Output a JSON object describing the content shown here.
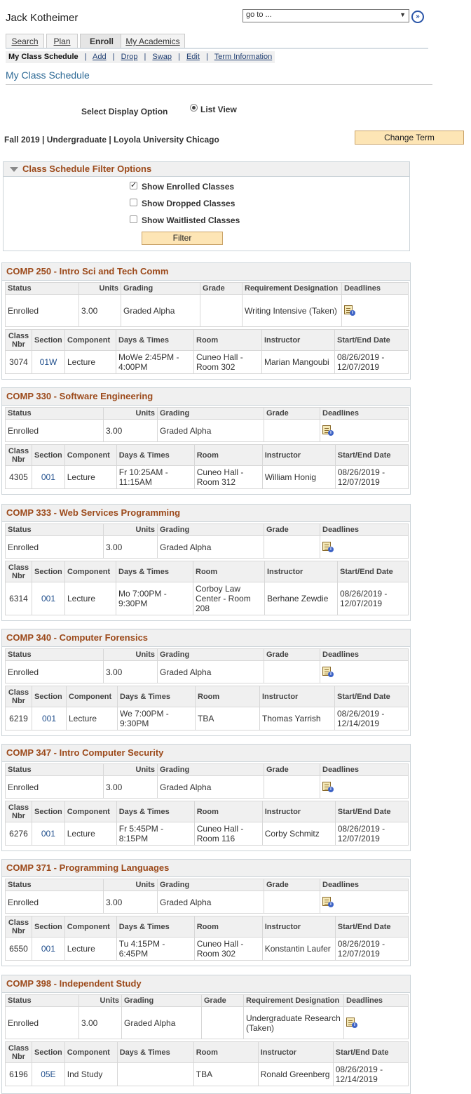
{
  "user_name": "Jack Kotheimer",
  "goto": {
    "value": "go to ..."
  },
  "tabs": [
    {
      "label": "Search"
    },
    {
      "label": "Plan"
    },
    {
      "label": "Enroll"
    },
    {
      "label": "My Academics"
    }
  ],
  "subnav": {
    "current": "My Class Schedule",
    "links": [
      "Add",
      "Drop",
      "Swap",
      "Edit",
      "Term Information"
    ]
  },
  "page_title": "My Class Schedule",
  "display_option": {
    "label": "Select Display Option",
    "radio_label": "List View"
  },
  "term_line": "Fall 2019 | Undergraduate | Loyola University Chicago",
  "change_term_label": "Change Term",
  "filter": {
    "title": "Class Schedule Filter Options",
    "options": [
      {
        "label": "Show Enrolled Classes",
        "checked": true
      },
      {
        "label": "Show Dropped Classes",
        "checked": false
      },
      {
        "label": "Show Waitlisted Classes",
        "checked": false
      }
    ],
    "button": "Filter"
  },
  "headers": {
    "status": "Status",
    "units": "Units",
    "grading": "Grading",
    "grade": "Grade",
    "requirement": "Requirement Designation",
    "deadlines": "Deadlines",
    "class_nbr": "Class Nbr",
    "section": "Section",
    "component": "Component",
    "days_times": "Days & Times",
    "room": "Room",
    "instructor": "Instructor",
    "start_end": "Start/End Date"
  },
  "courses": [
    {
      "title": "COMP 250 - Intro Sci and Tech Comm",
      "status": "Enrolled",
      "units": "3.00",
      "grading": "Graded Alpha",
      "grade": "",
      "requirement": "Writing Intensive (Taken)",
      "class_nbr": "3074",
      "section": "01W",
      "component": "Lecture",
      "days_times": "MoWe 2:45PM - 4:00PM",
      "room": "Cuneo Hall - Room 302",
      "instructor": "Marian Mangoubi",
      "start_end": "08/26/2019 - 12/07/2019"
    },
    {
      "title": "COMP 330 - Software Engineering",
      "status": "Enrolled",
      "units": "3.00",
      "grading": "Graded Alpha",
      "grade": "",
      "class_nbr": "4305",
      "section": "001",
      "component": "Lecture",
      "days_times": "Fr 10:25AM - 11:15AM",
      "room": "Cuneo Hall - Room 312",
      "instructor": "William Honig",
      "start_end": "08/26/2019 - 12/07/2019"
    },
    {
      "title": "COMP 333 - Web Services Programming",
      "status": "Enrolled",
      "units": "3.00",
      "grading": "Graded Alpha",
      "grade": "",
      "class_nbr": "6314",
      "section": "001",
      "component": "Lecture",
      "days_times": "Mo 7:00PM - 9:30PM",
      "room": "Corboy Law Center - Room 208",
      "instructor": "Berhane Zewdie",
      "start_end": "08/26/2019 - 12/07/2019"
    },
    {
      "title": "COMP 340 - Computer Forensics",
      "status": "Enrolled",
      "units": "3.00",
      "grading": "Graded Alpha",
      "grade": "",
      "class_nbr": "6219",
      "section": "001",
      "component": "Lecture",
      "days_times": "We 7:00PM - 9:30PM",
      "room": "TBA",
      "instructor": "Thomas Yarrish",
      "start_end": "08/26/2019 - 12/14/2019"
    },
    {
      "title": "COMP 347 - Intro Computer Security",
      "status": "Enrolled",
      "units": "3.00",
      "grading": "Graded Alpha",
      "grade": "",
      "class_nbr": "6276",
      "section": "001",
      "component": "Lecture",
      "days_times": "Fr 5:45PM - 8:15PM",
      "room": "Cuneo Hall - Room 116",
      "instructor": "Corby Schmitz",
      "start_end": "08/26/2019 - 12/07/2019"
    },
    {
      "title": "COMP 371 - Programming Languages",
      "status": "Enrolled",
      "units": "3.00",
      "grading": "Graded Alpha",
      "grade": "",
      "class_nbr": "6550",
      "section": "001",
      "component": "Lecture",
      "days_times": "Tu 4:15PM - 6:45PM",
      "room": "Cuneo Hall - Room 302",
      "instructor": "Konstantin Laufer",
      "start_end": "08/26/2019 - 12/07/2019"
    },
    {
      "title": "COMP 398 - Independent Study",
      "status": "Enrolled",
      "units": "3.00",
      "grading": "Graded Alpha",
      "grade": "",
      "requirement": "Undergraduate Research (Taken)",
      "class_nbr": "6196",
      "section": "05E",
      "component": "Ind Study",
      "days_times": "",
      "room": "TBA",
      "instructor": "Ronald Greenberg",
      "start_end": "08/26/2019 - 12/14/2019"
    }
  ]
}
